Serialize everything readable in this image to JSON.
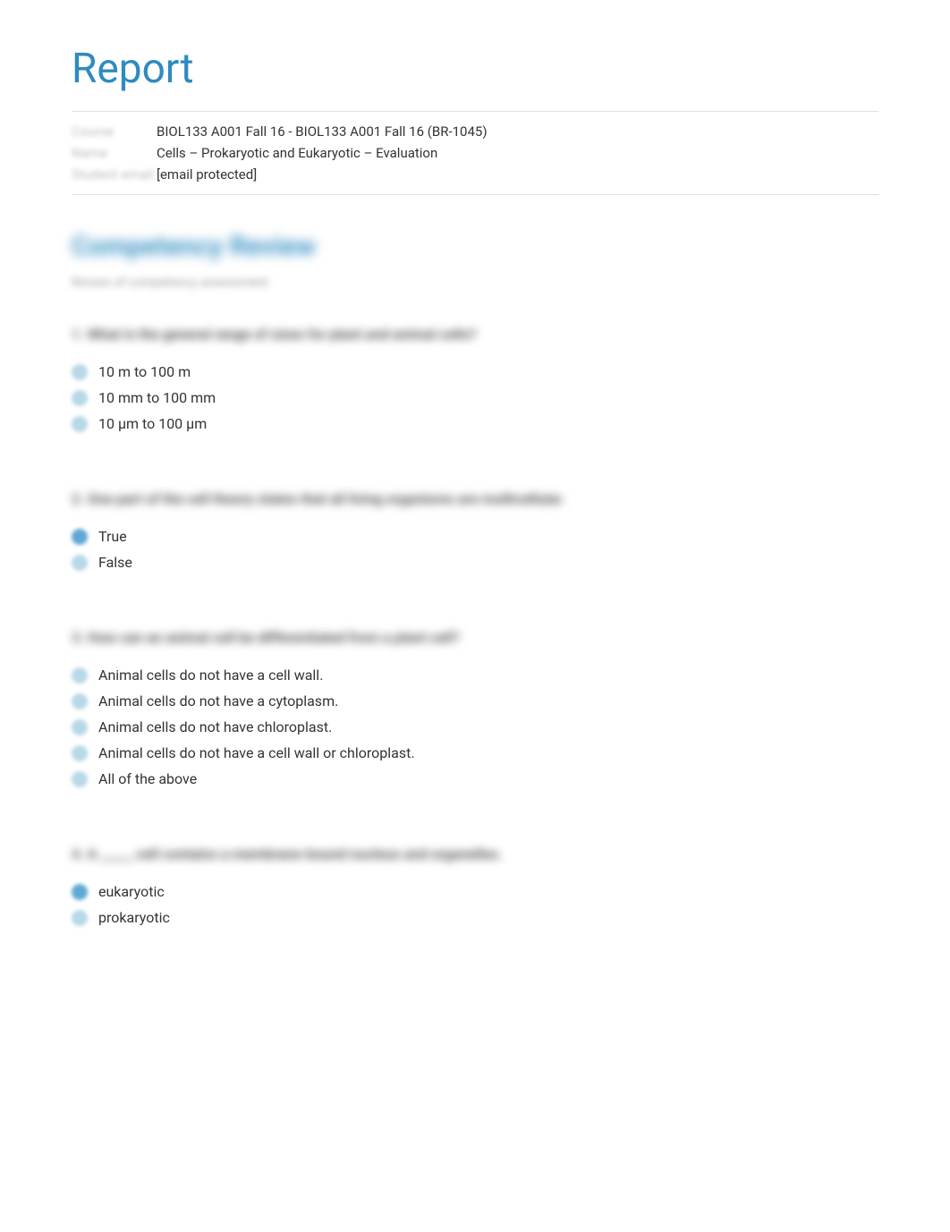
{
  "header": {
    "title": "Report",
    "meta": [
      {
        "label": "Course",
        "value": "BIOL133 A001 Fall 16 - BIOL133 A001 Fall 16 (BR-1045)"
      },
      {
        "label": "Name",
        "value": "Cells – Prokaryotic and Eukaryotic – Evaluation"
      },
      {
        "label": "Student email",
        "value": "[email protected]"
      }
    ]
  },
  "section": {
    "heading": "Competency Review",
    "subtext": "Review of competency assessment"
  },
  "questions": [
    {
      "prompt": "1. What is the general range of sizes for plant and animal cells?",
      "options": [
        {
          "label": "10 m to 100 m",
          "selected": false
        },
        {
          "label": "10 mm to 100 mm",
          "selected": false
        },
        {
          "label": "10 µm to 100 µm",
          "selected": false
        }
      ]
    },
    {
      "prompt": "2. One part of the cell theory states that all living organisms are multicellular.",
      "options": [
        {
          "label": "True",
          "selected": true
        },
        {
          "label": "False",
          "selected": false
        }
      ]
    },
    {
      "prompt": "3. How can an animal cell be differentiated from a plant cell?",
      "options": [
        {
          "label": "Animal cells do not have a cell wall.",
          "selected": false
        },
        {
          "label": "Animal cells do not have a cytoplasm.",
          "selected": false
        },
        {
          "label": "Animal cells do not have chloroplast.",
          "selected": false
        },
        {
          "label": "Animal cells do not have a cell wall or chloroplast.",
          "selected": false
        },
        {
          "label": "All of the above",
          "selected": false
        }
      ]
    },
    {
      "prompt": "4. A _____ cell contains a membrane-bound nucleus and organelles.",
      "options": [
        {
          "label": "eukaryotic",
          "selected": true
        },
        {
          "label": "prokaryotic",
          "selected": false
        }
      ]
    }
  ]
}
